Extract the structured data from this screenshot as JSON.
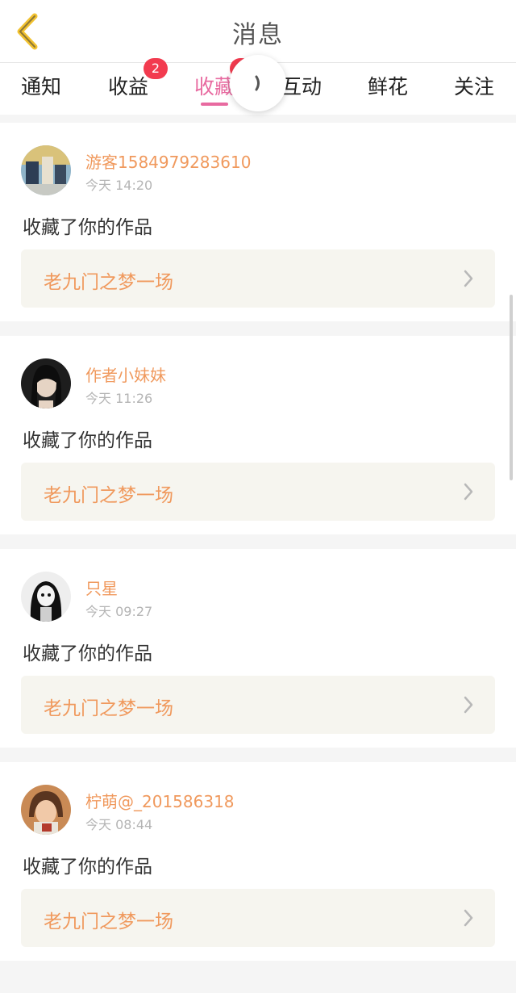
{
  "header": {
    "title": "消息",
    "back_icon": "chevron-left-icon",
    "back_color": "#f2c230"
  },
  "tabs": [
    {
      "label": "通知",
      "badge": ""
    },
    {
      "label": "收益",
      "badge": "2"
    },
    {
      "label": "收藏",
      "badge": "",
      "active": true
    },
    {
      "label": "互动",
      "badge": ""
    },
    {
      "label": "鲜花",
      "badge": ""
    },
    {
      "label": "关注",
      "badge": ""
    }
  ],
  "colors": {
    "accent": "#e86aa0",
    "username": "#f0995d",
    "badge": "#f23b4f"
  },
  "messages": [
    {
      "username": "游客1584979283610",
      "time": "今天 14:20",
      "action": "收藏了你的作品",
      "work": "老九门之梦一场",
      "avatar_icon": "avatar-photo-icon"
    },
    {
      "username": "作者小妹妹",
      "time": "今天 11:26",
      "action": "收藏了你的作品",
      "work": "老九门之梦一场",
      "avatar_icon": "avatar-photo-icon"
    },
    {
      "username": "只星",
      "time": "今天 09:27",
      "action": "收藏了你的作品",
      "work": "老九门之梦一场",
      "avatar_icon": "avatar-photo-icon"
    },
    {
      "username": "柠萌@_201586318",
      "time": "今天 08:44",
      "action": "收藏了你的作品",
      "work": "老九门之梦一场",
      "avatar_icon": "avatar-photo-icon"
    }
  ]
}
